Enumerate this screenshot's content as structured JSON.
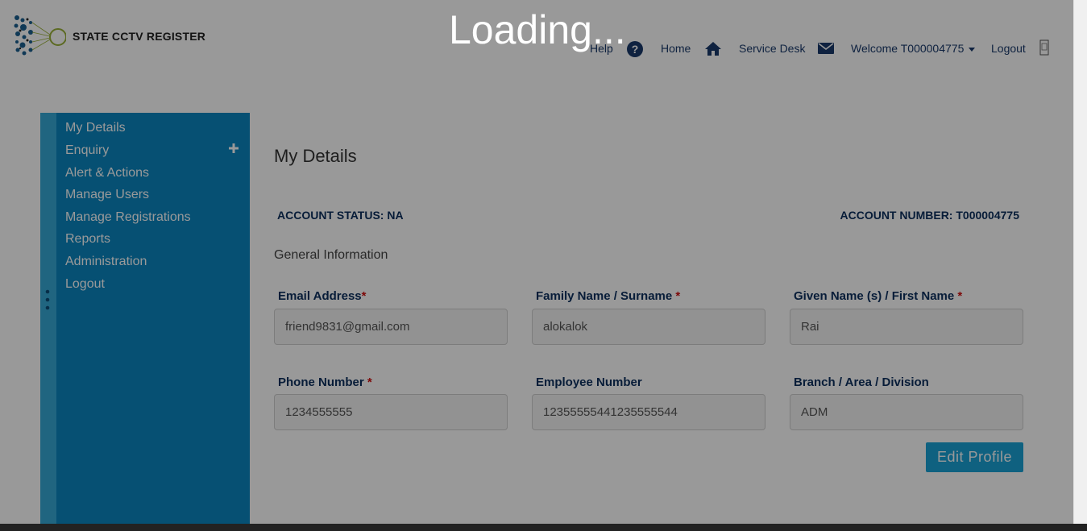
{
  "header": {
    "logo_text": "STATE CCTV REGISTER",
    "nav": {
      "help": "Help",
      "home": "Home",
      "service_desk": "Service Desk",
      "welcome": "Welcome T000004775",
      "logout": "Logout"
    },
    "icons": [
      "help-circle-icon",
      "home-icon",
      "mail-icon",
      "chevron-down-icon",
      "logout-icon"
    ]
  },
  "sidebar": {
    "items": [
      {
        "label": "My Details"
      },
      {
        "label": "Enquiry"
      },
      {
        "label": "Alert & Actions"
      },
      {
        "label": "Manage Users"
      },
      {
        "label": "Manage Registrations"
      },
      {
        "label": "Reports"
      },
      {
        "label": "Administration"
      },
      {
        "label": "Logout"
      }
    ]
  },
  "main": {
    "title": "My Details",
    "account_status": "ACCOUNT STATUS: NA",
    "account_number": "ACCOUNT NUMBER: T000004775",
    "section_title": "General Information",
    "fields": {
      "email": {
        "label": "Email Address",
        "value": "friend9831@gmail.com"
      },
      "surname": {
        "label": "Family Name / Surname",
        "value": "alokalok"
      },
      "first_name": {
        "label": "Given Name (s) / First Name",
        "value": "Rai"
      },
      "phone": {
        "label": "Phone Number",
        "value": "1234555555"
      },
      "employee": {
        "label": "Employee Number",
        "value": "12355555441235555544"
      },
      "branch": {
        "label": "Branch / Area / Division",
        "value": "ADM"
      }
    },
    "required_mark": "*",
    "edit_button": "Edit Profile"
  },
  "overlay": {
    "loading_text": "Loading..."
  },
  "colors": {
    "sidebar": "#0a86c0",
    "sidebar_strip": "#36a9d6",
    "label_navy": "#0c2f5e",
    "button": "#1aa2d6",
    "required": "#d01010"
  }
}
